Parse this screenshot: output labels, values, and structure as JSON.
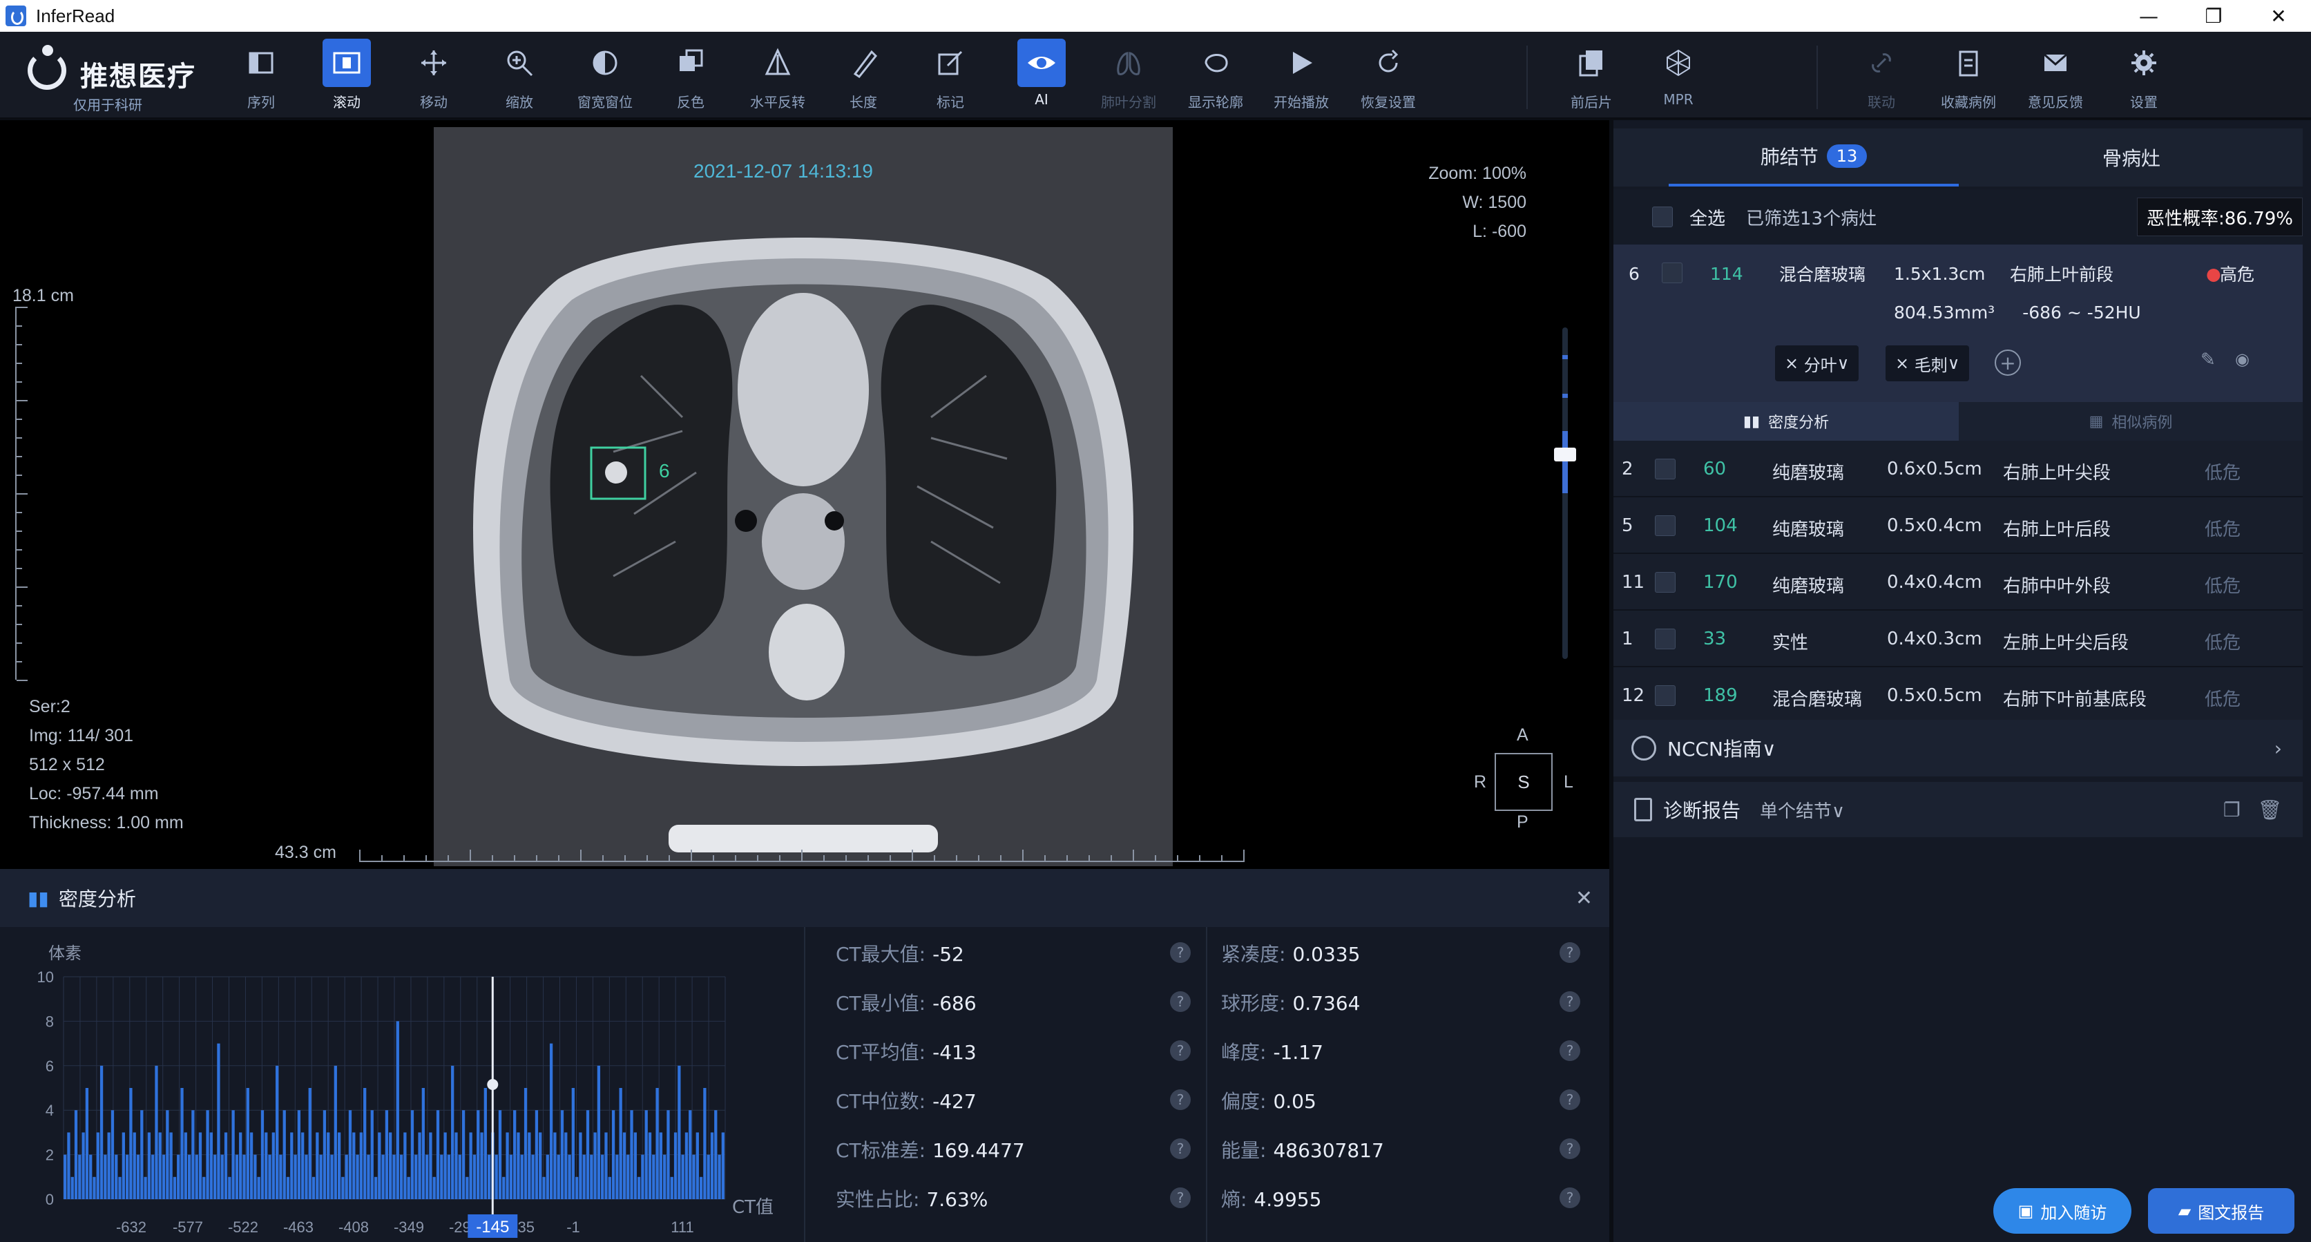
{
  "window": {
    "title": "InferRead",
    "minimize": "—",
    "restore": "❐",
    "close": "✕"
  },
  "logo": {
    "name": "推想医疗",
    "subtitle": "仅用于科研"
  },
  "toolbar": [
    {
      "label": "序列",
      "icon": "series-icon",
      "state": "normal"
    },
    {
      "label": "滚动",
      "icon": "scroll-icon",
      "state": "active"
    },
    {
      "label": "移动",
      "icon": "move-icon",
      "state": "normal"
    },
    {
      "label": "缩放",
      "icon": "zoom-icon",
      "state": "normal"
    },
    {
      "label": "窗宽窗位",
      "icon": "window-level-icon",
      "state": "normal"
    },
    {
      "label": "反色",
      "icon": "invert-icon",
      "state": "normal"
    },
    {
      "label": "水平反转",
      "icon": "flip-icon",
      "state": "normal"
    },
    {
      "label": "长度",
      "icon": "ruler-icon",
      "state": "normal"
    },
    {
      "label": "标记",
      "icon": "annotate-icon",
      "state": "normal"
    },
    {
      "label": "AI",
      "icon": "eye-icon",
      "state": "active"
    },
    {
      "label": "肺叶分割",
      "icon": "lung-icon",
      "state": "dim"
    },
    {
      "label": "显示轮廓",
      "icon": "contour-icon",
      "state": "normal"
    },
    {
      "label": "开始播放",
      "icon": "play-icon",
      "state": "normal"
    },
    {
      "label": "恢复设置",
      "icon": "reset-icon",
      "state": "normal"
    },
    {
      "label": "前后片",
      "icon": "compare-icon",
      "state": "normal"
    },
    {
      "label": "MPR",
      "icon": "mpr-icon",
      "state": "normal"
    },
    {
      "label": "联动",
      "icon": "link-icon",
      "state": "dim"
    },
    {
      "label": "收藏病例",
      "icon": "favorite-icon",
      "state": "normal"
    },
    {
      "label": "意见反馈",
      "icon": "feedback-icon",
      "state": "normal"
    },
    {
      "label": "设置",
      "icon": "settings-icon",
      "state": "normal"
    }
  ],
  "viewer": {
    "datetime": "2021-12-07 14:13:19",
    "zoom": "Zoom: 100%",
    "w": "W: 1500",
    "l": "L: -600",
    "vscale": "18.1 cm",
    "hscale": "43.3 cm",
    "ser": "Ser:2",
    "img": "Img: 114/ 301",
    "matrix": "512 x 512",
    "loc": "Loc: -957.44 mm",
    "thickness": "Thickness: 1.00 mm",
    "marker_label": "6",
    "orient": {
      "top": "A",
      "bottom": "P",
      "left": "R",
      "right": "L",
      "center": "S"
    }
  },
  "panel": {
    "tab_nodule": "肺结节",
    "tab_nodule_count": "13",
    "tab_bone": "骨病灶",
    "select_all": "全选",
    "filtered": "已筛选13个病灶",
    "malignancy": "恶性概率:86.79%",
    "selected": {
      "idx": "6",
      "img": "114",
      "type": "混合磨玻璃",
      "size": "1.5x1.3cm",
      "location": "右肺上叶前段",
      "risk": "高危",
      "volume": "804.53mm³",
      "hu": "-686 ~ -52HU",
      "tag1": "分叶",
      "tag2": "毛刺"
    },
    "subtab_density": "密度分析",
    "subtab_followup": "相似病例",
    "rows": [
      {
        "idx": "2",
        "img": "60",
        "type": "纯磨玻璃",
        "size": "0.6x0.5cm",
        "location": "右肺上叶尖段",
        "risk": "低危"
      },
      {
        "idx": "5",
        "img": "104",
        "type": "纯磨玻璃",
        "size": "0.5x0.4cm",
        "location": "右肺上叶后段",
        "risk": "低危"
      },
      {
        "idx": "11",
        "img": "170",
        "type": "纯磨玻璃",
        "size": "0.4x0.4cm",
        "location": "右肺中叶外段",
        "risk": "低危"
      },
      {
        "idx": "1",
        "img": "33",
        "type": "实性",
        "size": "0.4x0.3cm",
        "location": "左肺上叶尖后段",
        "risk": "低危"
      },
      {
        "idx": "12",
        "img": "189",
        "type": "混合磨玻璃",
        "size": "0.5x0.5cm",
        "location": "右肺下叶前基底段",
        "risk": "低危"
      }
    ],
    "nccn": "NCCN指南∨",
    "report": "诊断报告",
    "report_mode": "单个结节∨",
    "btn_followup": "加入随访",
    "btn_report": "图文报告"
  },
  "density": {
    "title": "密度分析",
    "ylabel": "体素",
    "xlabel": "CT值",
    "cursor_label": "-145",
    "stats": [
      {
        "k": "CT最大值:",
        "v": "-52"
      },
      {
        "k": "CT最小值:",
        "v": "-686"
      },
      {
        "k": "CT平均值:",
        "v": "-413"
      },
      {
        "k": "CT中位数:",
        "v": "-427"
      },
      {
        "k": "CT标准差:",
        "v": "169.4477"
      },
      {
        "k": "实性占比:",
        "v": "7.63%"
      }
    ],
    "stats2": [
      {
        "k": "紧凑度:",
        "v": "0.0335"
      },
      {
        "k": "球形度:",
        "v": "0.7364"
      },
      {
        "k": "峰度:",
        "v": "-1.17"
      },
      {
        "k": "偏度:",
        "v": "0.05"
      },
      {
        "k": "能量:",
        "v": "486307817"
      },
      {
        "k": "熵:",
        "v": "4.9955"
      }
    ]
  },
  "chart_data": {
    "type": "bar",
    "title": "",
    "xlabel": "CT值",
    "ylabel": "体素",
    "ylim": [
      0,
      10
    ],
    "xlim": [
      -686,
      -52
    ],
    "yticks": [
      "0",
      "2",
      "4",
      "6",
      "8",
      "10"
    ],
    "xticks": [
      "-632",
      "-577",
      "-522",
      "-463",
      "-408",
      "-349",
      "-294",
      "-235",
      "-1",
      "111"
    ],
    "cursor_x": -145,
    "values": [
      2,
      3,
      1,
      4,
      2,
      3,
      5,
      2,
      1,
      3,
      6,
      2,
      3,
      4,
      2,
      1,
      3,
      2,
      5,
      3,
      2,
      4,
      1,
      3,
      2,
      6,
      3,
      2,
      4,
      3,
      1,
      2,
      5,
      3,
      2,
      4,
      2,
      3,
      1,
      4,
      3,
      2,
      7,
      2,
      3,
      1,
      4,
      2,
      3,
      2,
      5,
      3,
      2,
      1,
      4,
      3,
      2,
      3,
      6,
      2,
      4,
      1,
      3,
      2,
      4,
      3,
      2,
      5,
      1,
      3,
      2,
      4,
      3,
      2,
      6,
      3,
      1,
      2,
      4,
      3,
      2,
      3,
      5,
      2,
      4,
      1,
      3,
      2,
      4,
      3,
      2,
      8,
      2,
      3,
      1,
      4,
      2,
      3,
      5,
      2,
      3,
      1,
      4,
      2,
      3,
      2,
      6,
      3,
      2,
      4,
      1,
      3,
      2,
      4,
      3,
      5,
      2,
      3,
      2,
      4,
      1,
      3,
      2,
      4,
      3,
      2,
      5,
      3,
      2,
      4,
      3,
      1,
      2,
      7,
      3,
      2,
      4,
      3,
      2,
      5,
      1,
      3,
      2,
      4,
      2,
      3,
      6,
      2,
      3,
      1,
      4,
      2,
      5,
      3,
      2,
      4,
      3,
      1,
      2,
      4,
      3,
      2,
      5,
      3,
      2,
      4,
      1,
      3,
      6,
      2,
      3,
      4,
      2,
      3,
      1,
      5,
      2,
      3,
      4,
      2,
      3
    ]
  }
}
